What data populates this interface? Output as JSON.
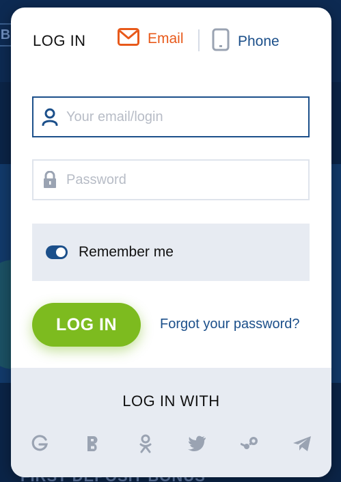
{
  "background": {
    "badge_letter": "B",
    "bottom_text": "FIRST DEPOSIT BONUS"
  },
  "modal": {
    "title": "LOG IN",
    "tabs": [
      {
        "label": "Email",
        "icon": "envelope-icon",
        "active": true
      },
      {
        "label": "Phone",
        "icon": "phone-icon",
        "active": false
      }
    ],
    "email_field": {
      "placeholder": "Your email/login",
      "value": ""
    },
    "password_field": {
      "placeholder": "Password",
      "value": ""
    },
    "remember": {
      "label": "Remember me",
      "checked": true
    },
    "login_button": "LOG IN",
    "forgot_link": "Forgot your password?",
    "footer": {
      "title": "LOG IN WITH",
      "providers": [
        "google-icon",
        "b-icon",
        "odnoklassniki-icon",
        "twitter-icon",
        "steam-icon",
        "telegram-icon"
      ]
    }
  },
  "colors": {
    "accent_orange": "#e8591a",
    "brand_blue": "#1b4f8a",
    "button_green": "#7dbb1f",
    "social_gray": "#9aa3b2"
  }
}
